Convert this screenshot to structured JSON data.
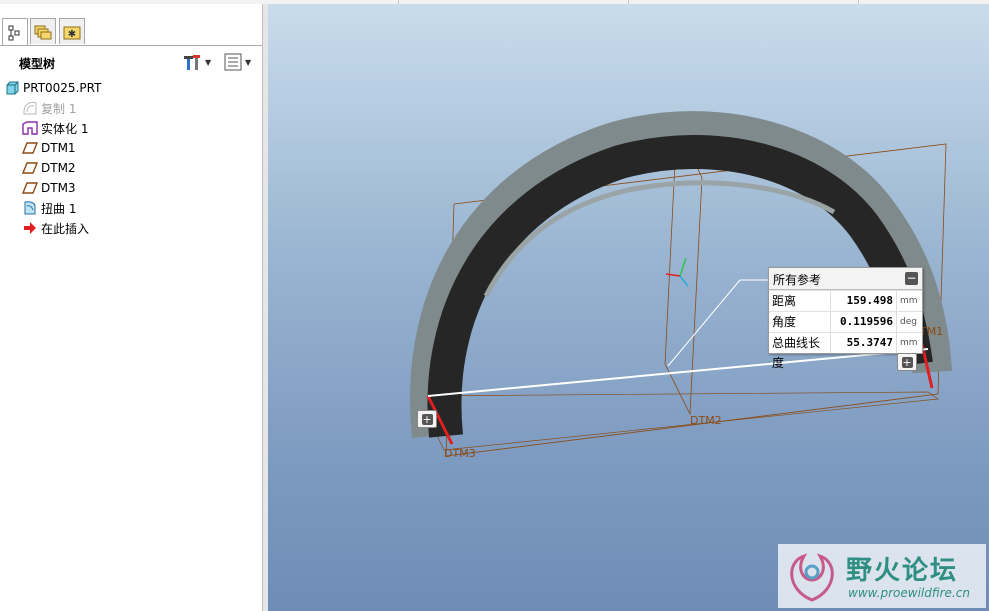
{
  "model_tree": {
    "title": "模型树",
    "items": [
      {
        "label": "PRT0025.PRT",
        "icon": "part-icon"
      },
      {
        "label": "复制 1",
        "icon": "copy-icon",
        "dimmed": true
      },
      {
        "label": "实体化 1",
        "icon": "solidify-icon"
      },
      {
        "label": "DTM1",
        "icon": "datum-plane-icon"
      },
      {
        "label": "DTM2",
        "icon": "datum-plane-icon"
      },
      {
        "label": "DTM3",
        "icon": "datum-plane-icon"
      },
      {
        "label": "扭曲 1",
        "icon": "warp-icon"
      },
      {
        "label": "在此插入",
        "icon": "insert-here-arrow-icon"
      }
    ]
  },
  "datum_labels": {
    "dtm1": "TM1",
    "dtm2": "DTM2",
    "dtm3": "DTM3"
  },
  "info_box": {
    "title": "所有参考",
    "rows": [
      {
        "name": "距离",
        "value": "159.498",
        "unit": "mm"
      },
      {
        "name": "角度",
        "value": "0.119596",
        "unit": "deg"
      },
      {
        "name": "总曲线长度",
        "value": "55.3747",
        "unit": "mm"
      }
    ]
  },
  "watermark": {
    "title": "野火论坛",
    "url": "www.proewildfire.cn"
  },
  "colors": {
    "datum": "#8b4a14",
    "ring": "#2a2a2a",
    "accent_red": "#e02020"
  }
}
